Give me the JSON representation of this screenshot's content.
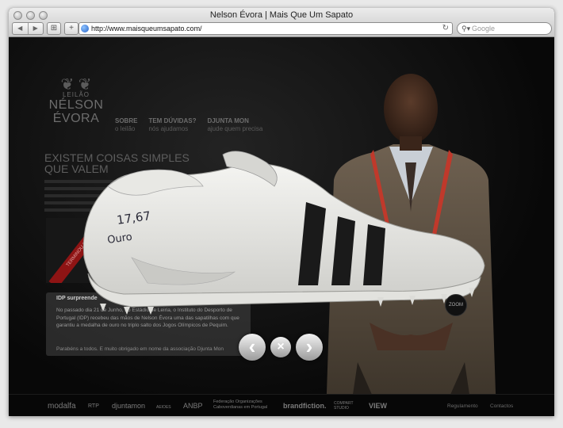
{
  "window": {
    "title": "Nelson Évora | Mais Que Um Sapato",
    "url": "http://www.maisqueumsapato.com/",
    "search_placeholder": "Google"
  },
  "brand": {
    "auction": "LEILÃO",
    "first_name": "NÉLSON",
    "last_name": "ÉVORA"
  },
  "menu": [
    {
      "title": "SOBRE",
      "subtitle": "o leilão"
    },
    {
      "title": "TEM DÚVIDAS?",
      "subtitle": "nós ajudamos"
    },
    {
      "title": "DJUNTA MON",
      "subtitle": "ajude quem precisa"
    }
  ],
  "headline": {
    "line1": "EXISTEM COISAS SIMPLES",
    "line2": "QUE VALEM"
  },
  "ribbon": "TERMINOU O LEILÃO",
  "news": {
    "title": "IDP surpreende",
    "body": "No passado dia 21 de Junho, no Estádio de Leiria, o Instituto do Desporto de Portugal (IDP) recebeu das mãos de Nelson Évora uma das sapatilhas com que garantiu a medalha de ouro no triplo salto dos Jogos Olímpicos de Pequim.",
    "thanks": "Parabéns a todos. E muito obrigado em nome da associação Djunta Mon"
  },
  "shoe": {
    "handwriting_line1": "17,67",
    "handwriting_line2": "Ouro"
  },
  "controls": {
    "zoom_label": "ZOOM",
    "prev_symbol": "‹",
    "close_symbol": "×",
    "next_symbol": "›"
  },
  "footer": {
    "sponsors": [
      "modalfa",
      "RTP",
      "djuntamon",
      "AEIOES",
      "ANBP",
      "Federação Organizações Caboverdianas em Portugal",
      "brandfiction.",
      "COMPART STUDIO",
      "VIEW"
    ],
    "links": [
      "Regulamento",
      "Contactos"
    ]
  },
  "colors": {
    "background": "#0b0b0b",
    "ribbon": "#8e1414",
    "lanyard": "#c0392b"
  }
}
